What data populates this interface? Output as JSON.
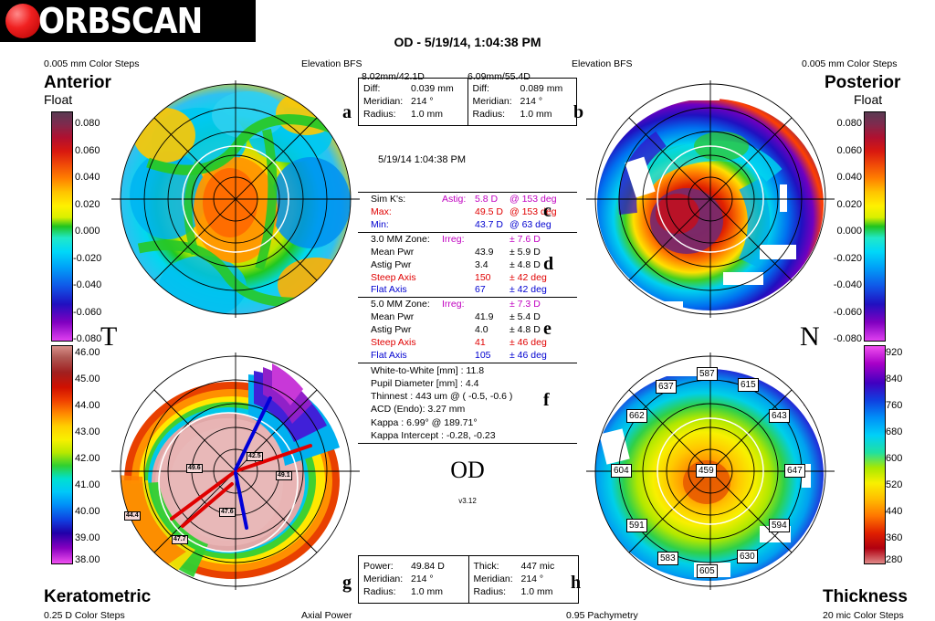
{
  "app": {
    "brand": "ORBSCAN",
    "version": "v3.12",
    "report_title": "OD - 5/19/14, 1:04:38 PM",
    "eye_label": "OD"
  },
  "quadrants": {
    "anterior": {
      "title": "Anterior",
      "subtitle": "Float",
      "steps": "0.005 mm Color Steps",
      "bfs_label": "Elevation BFS",
      "bfs_value": "8.02mm/42.1D",
      "marker": "a",
      "side_letter": "T"
    },
    "posterior": {
      "title": "Posterior",
      "subtitle": "Float",
      "steps": "0.005 mm Color Steps",
      "bfs_label": "Elevation BFS",
      "bfs_value": "6.09mm/55.4D",
      "marker": "b",
      "side_letter": "N"
    },
    "keratometric": {
      "title": "Keratometric",
      "steps": "0.25 D Color Steps",
      "footer": "Axial Power",
      "marker": "g"
    },
    "thickness": {
      "title": "Thickness",
      "steps": "20 mic Color Steps",
      "footer": "0.95 Pachymetry",
      "marker": "h"
    }
  },
  "boxes": {
    "anterior_diff": {
      "rows": [
        {
          "key": "Diff:",
          "value": "0.039 mm"
        },
        {
          "key": "Meridian:",
          "value": "214 °"
        },
        {
          "key": "Radius:",
          "value": "1.0 mm"
        }
      ]
    },
    "posterior_diff": {
      "rows": [
        {
          "key": "Diff:",
          "value": "0.089 mm"
        },
        {
          "key": "Meridian:",
          "value": "214 °"
        },
        {
          "key": "Radius:",
          "value": "1.0 mm"
        }
      ]
    },
    "power": {
      "rows": [
        {
          "key": "Power:",
          "value": "49.84 D"
        },
        {
          "key": "Meridian:",
          "value": "214 °"
        },
        {
          "key": "Radius:",
          "value": "1.0 mm"
        }
      ]
    },
    "thick": {
      "rows": [
        {
          "key": "Thick:",
          "value": "447 mic"
        },
        {
          "key": "Meridian:",
          "value": "214 °"
        },
        {
          "key": "Radius:",
          "value": "1.0 mm"
        }
      ]
    }
  },
  "exam_datetime": "5/19/14 1:04:38 PM",
  "sim_k": {
    "marker": "c",
    "rows": [
      {
        "name": "Sim K's:",
        "label": "Astig:",
        "value": "5.8 D",
        "axis": "@ 153 deg",
        "color": "magenta"
      },
      {
        "name": "Max:",
        "label": "",
        "value": "49.5 D",
        "axis": "@ 153 deg",
        "color": "red"
      },
      {
        "name": "Min:",
        "label": "",
        "value": "43.7 D",
        "axis": "@ 63 deg",
        "color": "blue"
      }
    ]
  },
  "zone_3mm": {
    "marker": "d",
    "rows": [
      {
        "name": "3.0 MM Zone:",
        "label": "Irreg:",
        "value": "",
        "axis": "± 7.6 D",
        "color": "magenta"
      },
      {
        "name": "Mean Pwr",
        "label": "",
        "value": "43.9",
        "axis": "± 5.9 D",
        "color": "black"
      },
      {
        "name": "Astig Pwr",
        "label": "",
        "value": "3.4",
        "axis": "± 4.8 D",
        "color": "black"
      },
      {
        "name": "Steep Axis",
        "label": "",
        "value": "150",
        "axis": "± 42 deg",
        "color": "red"
      },
      {
        "name": "Flat Axis",
        "label": "",
        "value": "67",
        "axis": "± 42 deg",
        "color": "blue"
      }
    ]
  },
  "zone_5mm": {
    "marker": "e",
    "rows": [
      {
        "name": "5.0 MM Zone:",
        "label": "Irreg:",
        "value": "",
        "axis": "± 7.3 D",
        "color": "magenta"
      },
      {
        "name": "Mean Pwr",
        "label": "",
        "value": "41.9",
        "axis": "± 5.4 D",
        "color": "black"
      },
      {
        "name": "Astig Pwr",
        "label": "",
        "value": "4.0",
        "axis": "± 4.8 D",
        "color": "black"
      },
      {
        "name": "Steep Axis",
        "label": "",
        "value": "41",
        "axis": "± 46 deg",
        "color": "red"
      },
      {
        "name": "Flat Axis",
        "label": "",
        "value": "105",
        "axis": "± 46 deg",
        "color": "blue"
      }
    ]
  },
  "measurements": {
    "marker": "f",
    "lines": [
      "White-to-White [mm] : 11.8",
      "Pupil Diameter [mm] :  4.4",
      "Thinnest : 443 um @ ( -0.5, -0.6 )",
      "ACD (Endo): 3.27 mm",
      "Kappa : 6.99° @ 189.71°",
      "Kappa Intercept : -0.28, -0.23"
    ]
  },
  "chart_data": [
    {
      "type": "heatmap",
      "title": "Anterior Elevation BFS Float",
      "unit": "mm",
      "colorbar_ticks": [
        "0.080",
        "0.060",
        "0.040",
        "0.020",
        "0.000",
        "-0.020",
        "-0.040",
        "-0.060",
        "-0.080"
      ],
      "colorbar_range": [
        -0.09,
        0.09
      ],
      "step": 0.005,
      "bfs": "8.02mm/42.1D",
      "center_value": "0.039"
    },
    {
      "type": "heatmap",
      "title": "Posterior Elevation BFS Float",
      "unit": "mm",
      "colorbar_ticks": [
        "0.080",
        "0.060",
        "0.040",
        "0.020",
        "0.000",
        "-0.020",
        "-0.040",
        "-0.060",
        "-0.080"
      ],
      "colorbar_range": [
        -0.09,
        0.09
      ],
      "step": 0.005,
      "bfs": "6.09mm/55.4D",
      "center_value": "0.089"
    },
    {
      "type": "heatmap",
      "title": "Keratometric Axial Power",
      "unit": "D",
      "colorbar_ticks": [
        "46.00",
        "45.00",
        "44.00",
        "43.00",
        "42.00",
        "41.00",
        "40.00",
        "39.00",
        "38.00"
      ],
      "colorbar_range": [
        38.0,
        46.0
      ],
      "step": 0.25,
      "annotations": [
        {
          "label": "42.5",
          "x": 0.62,
          "y": 0.27
        },
        {
          "label": "49.1",
          "x": 0.73,
          "y": 0.5
        },
        {
          "label": "49.6",
          "x": 0.35,
          "y": 0.47
        },
        {
          "label": "47.6",
          "x": 0.5,
          "y": 0.66
        },
        {
          "label": "47.7",
          "x": 0.3,
          "y": 0.8
        },
        {
          "label": "44.4",
          "x": 0.1,
          "y": 0.74
        }
      ]
    },
    {
      "type": "heatmap",
      "title": "Thickness Pachymetry",
      "unit": "mic",
      "colorbar_ticks": [
        "920",
        "840",
        "760",
        "680",
        "600",
        "520",
        "440",
        "360",
        "280"
      ],
      "colorbar_range": [
        280,
        960
      ],
      "step": 20,
      "annotations": [
        {
          "label": "459",
          "x": 0.5,
          "y": 0.5
        },
        {
          "label": "587",
          "x": 0.5,
          "y": 0.12
        },
        {
          "label": "637",
          "x": 0.33,
          "y": 0.18
        },
        {
          "label": "615",
          "x": 0.67,
          "y": 0.17
        },
        {
          "label": "662",
          "x": 0.22,
          "y": 0.33
        },
        {
          "label": "643",
          "x": 0.79,
          "y": 0.33
        },
        {
          "label": "604",
          "x": 0.16,
          "y": 0.53
        },
        {
          "label": "647",
          "x": 0.85,
          "y": 0.53
        },
        {
          "label": "591",
          "x": 0.22,
          "y": 0.72
        },
        {
          "label": "594",
          "x": 0.79,
          "y": 0.72
        },
        {
          "label": "583",
          "x": 0.34,
          "y": 0.87
        },
        {
          "label": "630",
          "x": 0.67,
          "y": 0.87
        },
        {
          "label": "605",
          "x": 0.5,
          "y": 0.92
        }
      ]
    }
  ]
}
